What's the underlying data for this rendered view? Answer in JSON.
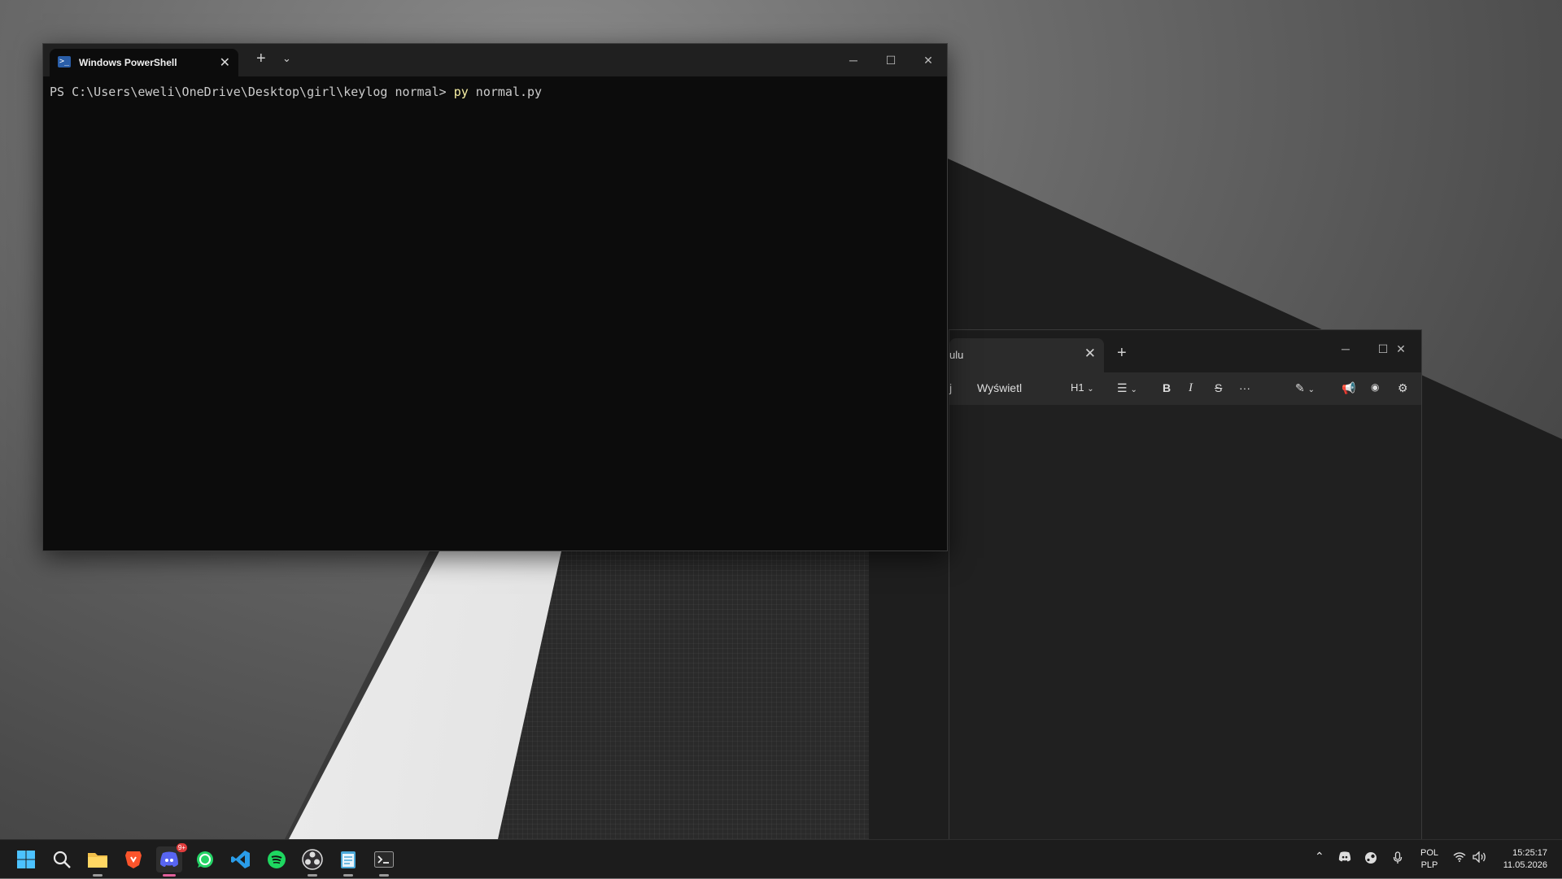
{
  "terminal": {
    "tab_title": "Windows PowerShell",
    "tab_icon": "powershell-icon",
    "prompt": "PS C:\\Users\\eweli\\OneDrive\\Desktop\\girl\\keylog normal> ",
    "command": "py",
    "args": " normal.py"
  },
  "notepad": {
    "tab_title": "ulu",
    "menu_fragment": "j",
    "menu_view": "Wyświetl",
    "heading_label": "H1"
  },
  "taskbar": {
    "apps": [
      "start-icon",
      "search-icon",
      "file-explorer-icon",
      "brave-icon",
      "discord-icon",
      "whatsapp-icon",
      "vscode-icon",
      "spotify-icon",
      "obs-icon",
      "notepad-icon",
      "terminal-icon"
    ],
    "discord_badge": "9+",
    "lang_top": "POL",
    "lang_bottom": "PLP",
    "time": "15:25:17",
    "date": "11.05.2026"
  },
  "colors": {
    "accent": "#60cdff",
    "terminal_bg": "#0c0c0c",
    "command_highlight": "#f9f1a5"
  }
}
